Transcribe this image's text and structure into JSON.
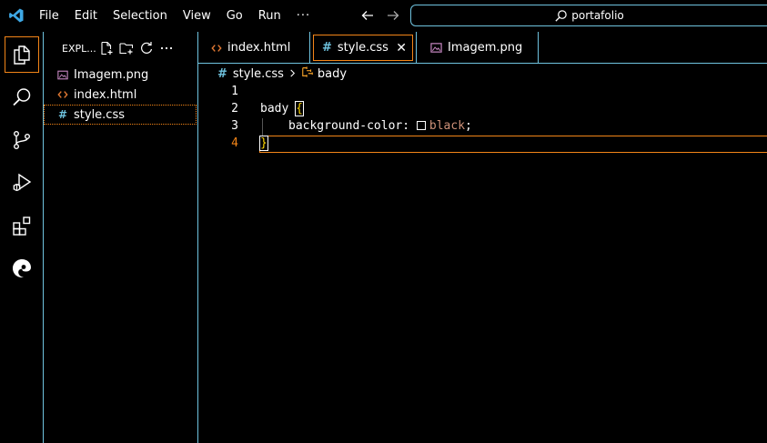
{
  "menu": {
    "items": [
      "File",
      "Edit",
      "Selection",
      "View",
      "Go",
      "Run"
    ],
    "more": "···"
  },
  "command_center": {
    "text": "portafolio"
  },
  "sidebar": {
    "title": "EXPL...",
    "files": [
      {
        "name": "Imagem.png",
        "icon": "image-file-icon"
      },
      {
        "name": "index.html",
        "icon": "html-file-icon"
      },
      {
        "name": "style.css",
        "icon": "css-file-icon"
      }
    ]
  },
  "tabs": [
    {
      "label": "index.html",
      "icon": "html-file-icon"
    },
    {
      "label": "style.css",
      "icon": "css-file-icon",
      "active": true
    },
    {
      "label": "Imagem.png",
      "icon": "image-file-icon"
    }
  ],
  "breadcrumb": {
    "file": "style.css",
    "symbol": "bady"
  },
  "editor": {
    "line_numbers": [
      "1",
      "2",
      "3",
      "4"
    ],
    "selector": "bady",
    "open_brace": "{",
    "property": "background-color:",
    "value": "black",
    "semicolon": ";",
    "close_brace": "}"
  },
  "colors": {
    "accent_border": "#6fc3df",
    "focus_border": "#f38518",
    "value": "#ce9178",
    "brace": "#ffd700"
  }
}
